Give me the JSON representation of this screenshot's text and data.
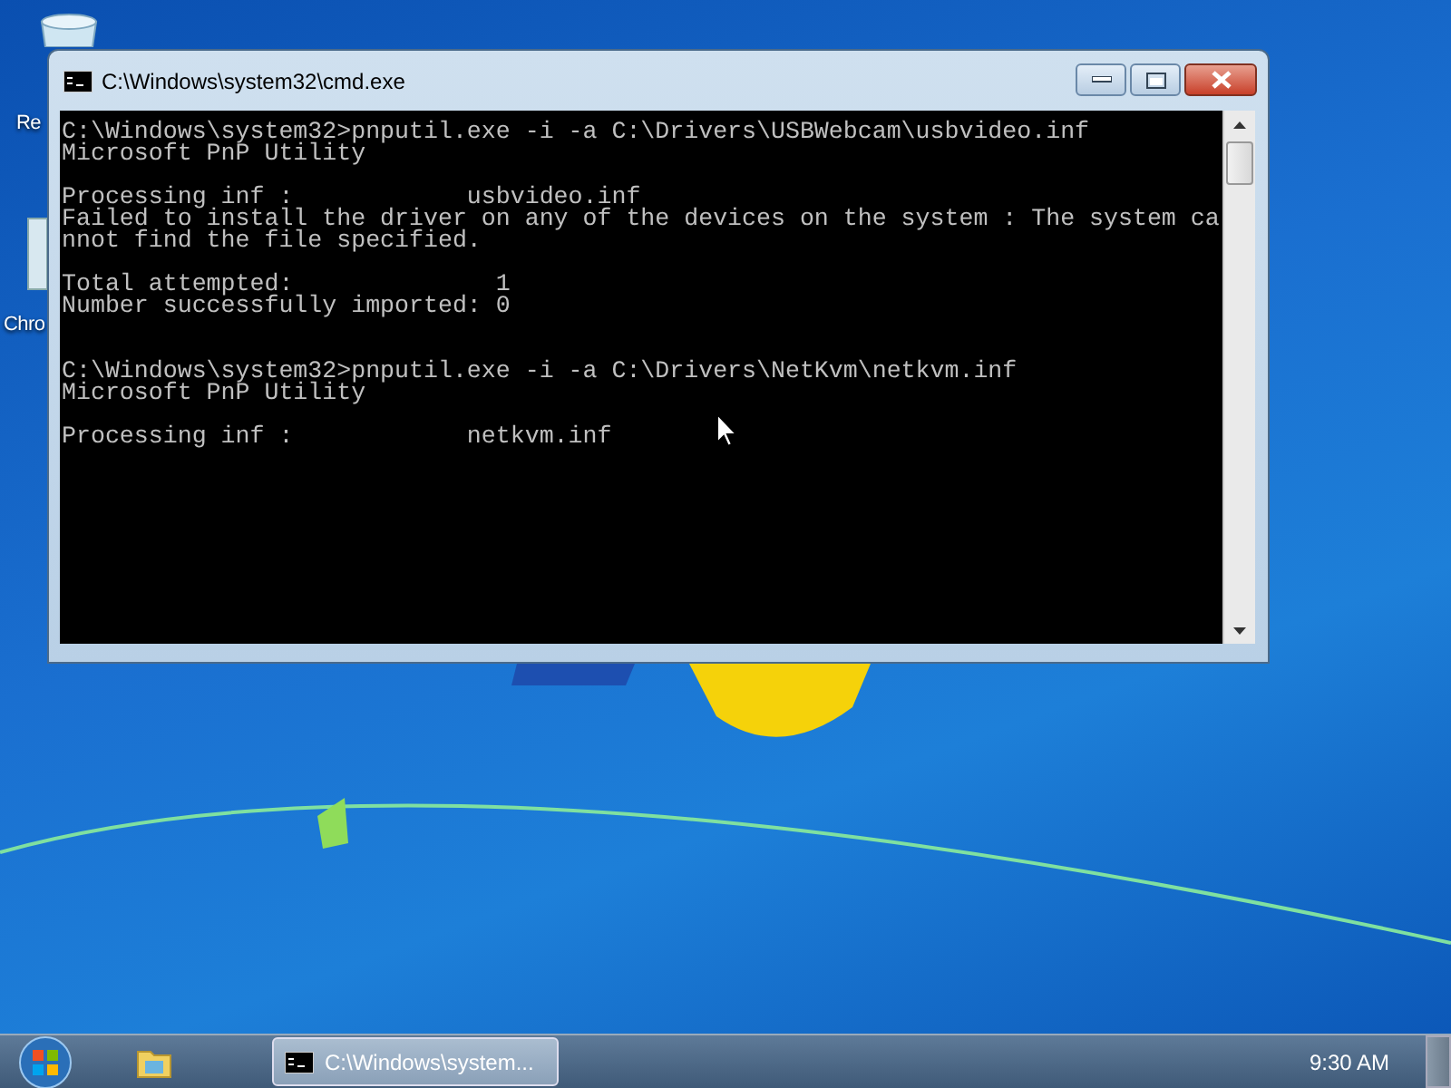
{
  "desktop": {
    "icons": [
      {
        "label": "Re",
        "kind": "recycle"
      },
      {
        "label": "Chro",
        "kind": "browser"
      }
    ]
  },
  "window": {
    "title": "C:\\Windows\\system32\\cmd.exe",
    "console": {
      "lines": [
        {
          "kind": "text",
          "text": "C:\\Windows\\system32>pnputil.exe -i -a C:\\Drivers\\USBWebcam\\usbvideo.inf"
        },
        {
          "kind": "text",
          "text": "Microsoft PnP Utility"
        },
        {
          "kind": "blank"
        },
        {
          "kind": "text",
          "text": "Processing inf :            usbvideo.inf"
        },
        {
          "kind": "text",
          "text": "Failed to install the driver on any of the devices on the system : The system ca"
        },
        {
          "kind": "text",
          "text": "nnot find the file specified."
        },
        {
          "kind": "blank"
        },
        {
          "kind": "text",
          "text": "Total attempted:              1"
        },
        {
          "kind": "text",
          "text": "Number successfully imported: 0"
        },
        {
          "kind": "blank"
        },
        {
          "kind": "blank"
        },
        {
          "kind": "text",
          "text": "C:\\Windows\\system32>pnputil.exe -i -a C:\\Drivers\\NetKvm\\netkvm.inf"
        },
        {
          "kind": "text",
          "text": "Microsoft PnP Utility"
        },
        {
          "kind": "blank"
        },
        {
          "kind": "text",
          "text": "Processing inf :            netkvm.inf"
        }
      ]
    }
  },
  "taskbar": {
    "task": {
      "title": "C:\\Windows\\system..."
    },
    "clock": "9:30 AM"
  }
}
